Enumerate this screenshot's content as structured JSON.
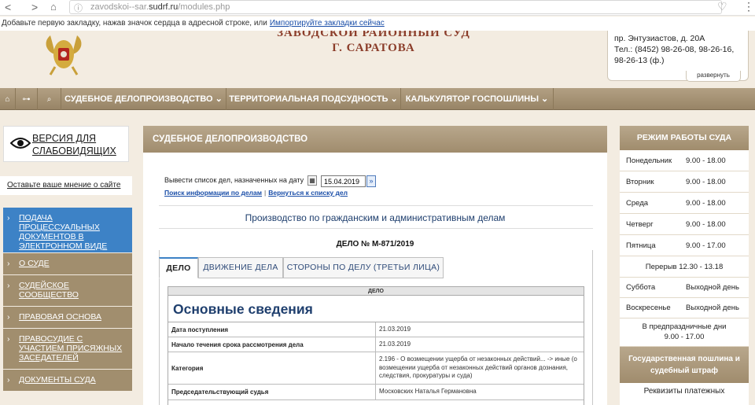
{
  "browser": {
    "back_icon": "back-arrow-icon",
    "forward_icon": "forward-arrow-icon",
    "url_prefix": "zavodskoi--sar.",
    "url_domain": "sudrf.ru",
    "url_path": "/modules.php",
    "bookmark_msg": "Добавьте первую закладку, нажав значок сердца в адресной строке, или",
    "bookmark_link": "Импортируйте закладки сейчас"
  },
  "header": {
    "title_line1": "ЗАВОДСКОЙ РАЙОННЫЙ СУД",
    "title_line2": "Г. САРАТОВА",
    "address": "пр. Энтузиастов, д. 20А",
    "phone_line1": "Тел.: (8452) 98-26-08, 98-26-16,",
    "phone_line2": "98-26-13 (ф.)",
    "expand_label": "развернуть"
  },
  "topnav": {
    "items": [
      {
        "label": "СУДЕБНОЕ ДЕЛОПРОИЗВОДСТВО ⌄"
      },
      {
        "label": "ТЕРРИТОРИАЛЬНАЯ ПОДСУДНОСТЬ ⌄"
      },
      {
        "label": "КАЛЬКУЛЯТОР ГОСПОШЛИНЫ ⌄"
      }
    ]
  },
  "sidebar": {
    "vision_line1": "ВЕРСИЯ ДЛЯ",
    "vision_line2": "СЛАБОВИДЯЩИХ",
    "opinion": "Оставьте ваше мнение о сайте",
    "items": [
      {
        "label": "ПОДАЧА ПРОЦЕССУАЛЬНЫХ ДОКУМЕНТОВ В ЭЛЕКТРОННОМ ВИДЕ"
      },
      {
        "label": "О СУДЕ"
      },
      {
        "label": "СУДЕЙСКОЕ СООБЩЕСТВО"
      },
      {
        "label": "ПРАВОВАЯ ОСНОВА"
      },
      {
        "label": "ПРАВОСУДИЕ С УЧАСТИЕМ ПРИСЯЖНЫХ ЗАСЕДАТЕЛЕЙ"
      },
      {
        "label": "ДОКУМЕНТЫ СУДА"
      }
    ]
  },
  "main": {
    "heading": "СУДЕБНОЕ ДЕЛОПРОИЗВОДСТВО",
    "date_label": "Вывести список дел, назначенных на дату",
    "date_value": "15.04.2019",
    "link_search": "Поиск информации по делам",
    "link_sep": "|",
    "link_back": "Вернуться к списку дел",
    "proc_title": "Производство по гражданским и административным делам",
    "case_no": "ДЕЛО № М-871/2019",
    "tabs": [
      {
        "label": "ДЕЛО"
      },
      {
        "label": "ДВИЖЕНИЕ ДЕЛА"
      },
      {
        "label": "СТОРОНЫ ПО ДЕЛУ (ТРЕТЬИ ЛИЦА)"
      }
    ],
    "inner_head": "ДЕЛО",
    "section_title": "Основные сведения",
    "rows": [
      {
        "key": "Дата поступления",
        "value": "21.03.2019"
      },
      {
        "key": "Начало течения срока рассмотрения дела",
        "value": "21.03.2019"
      },
      {
        "key": "Категория",
        "value": "2.196 - О возмещении ущерба от незаконных действий... -> иные (о возмещении ущерба от незаконных действий органов дознания, следствия, прокуратуры и суда)"
      },
      {
        "key": "Председательствующий судья",
        "value": "Московских Наталья Германовна"
      }
    ]
  },
  "schedule": {
    "heading": "РЕЖИМ РАБОТЫ СУДА",
    "days": [
      {
        "day": "Понедельник",
        "time": "9.00 - 18.00"
      },
      {
        "day": "Вторник",
        "time": "9.00 - 18.00"
      },
      {
        "day": "Среда",
        "time": "9.00 - 18.00"
      },
      {
        "day": "Четверг",
        "time": "9.00 - 18.00"
      },
      {
        "day": "Пятница",
        "time": "9.00 - 17.00"
      }
    ],
    "break": "Перерыв 12.30 - 13.18",
    "weekend": [
      {
        "day": "Суббота",
        "time": "Выходной день"
      },
      {
        "day": "Воскресенье",
        "time": "Выходной день"
      }
    ],
    "preholiday_line1": "В предпраздничные дни",
    "preholiday_line2": "9.00 - 17.00",
    "fee_heading_line1": "Государственная пошлина и",
    "fee_heading_line2": "судебный штраф",
    "fee_sub": "Реквизиты платежных"
  }
}
